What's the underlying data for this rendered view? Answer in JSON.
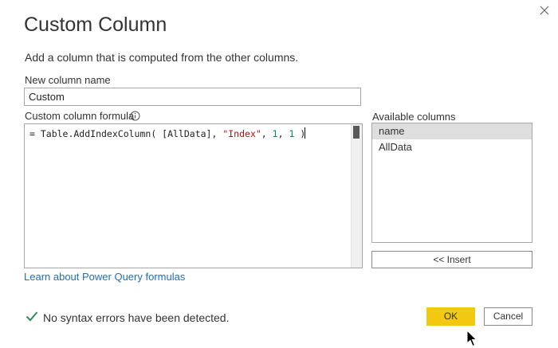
{
  "dialog": {
    "title": "Custom Column",
    "subtitle": "Add a column that is computed from the other columns."
  },
  "new_column": {
    "label": "New column name",
    "value": "Custom"
  },
  "formula": {
    "label": "Custom column formula",
    "prefix": "= Table.AddIndexColumn( [AllData], ",
    "string_literal": "\"Index\"",
    "separator_1": ", ",
    "arg_start": "1",
    "separator_2": ", ",
    "arg_step": "1",
    "suffix": " )"
  },
  "available_columns": {
    "label": "Available columns",
    "items": [
      {
        "label": "name",
        "selected": true
      },
      {
        "label": "AllData",
        "selected": false
      }
    ],
    "insert_label": "<< Insert"
  },
  "learn_link": "Learn about Power Query formulas",
  "status": {
    "text": "No syntax errors have been detected.",
    "icon": "checkmark-icon",
    "color": "#2e8b57"
  },
  "buttons": {
    "ok": "OK",
    "cancel": "Cancel"
  },
  "colors": {
    "ok_button": "#f2c811",
    "link": "#1f6fb3",
    "selected_row": "#dedede"
  }
}
